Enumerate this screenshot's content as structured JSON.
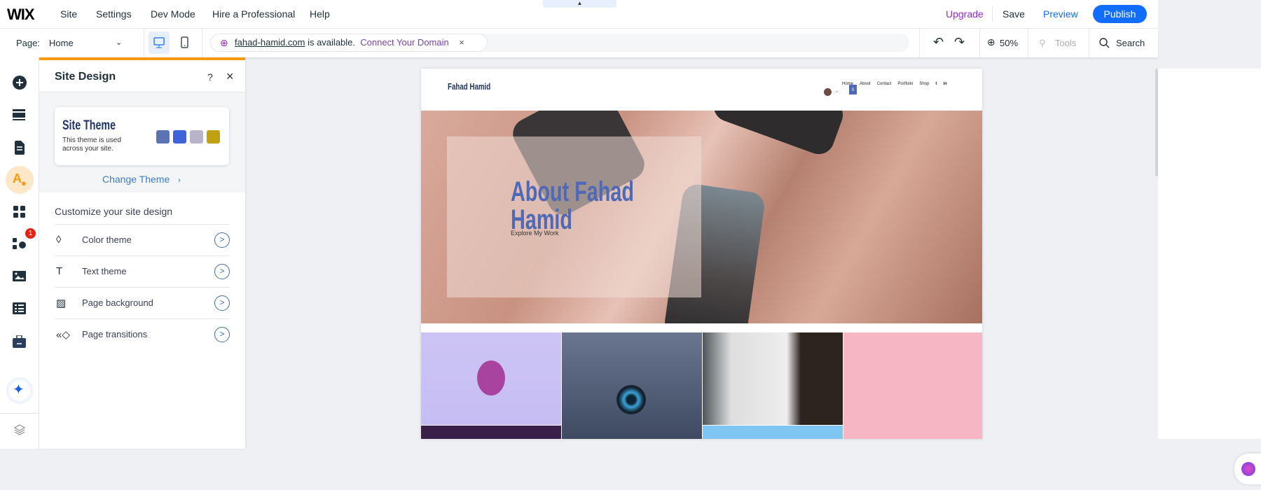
{
  "topbar": {
    "logo": "WIX",
    "menu": [
      "Site",
      "Settings",
      "Dev Mode",
      "Hire a Professional",
      "Help"
    ],
    "upgrade": "Upgrade",
    "save": "Save",
    "preview": "Preview",
    "publish": "Publish",
    "collapse_icon": "chevron-up-icon"
  },
  "toolbar": {
    "page_label": "Page:",
    "page_value": "Home",
    "domain": "fahad-hamid.com",
    "domain_suffix": "is available.",
    "connect": "Connect Your Domain",
    "dismiss": "×",
    "zoom": "50%",
    "tools": "Tools",
    "search": "Search"
  },
  "rail": {
    "badge": "1",
    "icons": [
      "add-icon",
      "sections-icon",
      "pages-icon",
      "site-design-icon",
      "apps-icon",
      "add-apps-icon",
      "media-icon",
      "cms-icon",
      "business-icon",
      "ai-assistant-icon",
      "layers-icon"
    ]
  },
  "panel": {
    "title": "Site Design",
    "help": "?",
    "close": "×",
    "theme": {
      "title": "Site Theme",
      "desc": "This theme is used across your site.",
      "colors": [
        "#5a73b5",
        "#3f63d9",
        "#b8b3c8",
        "#c0a10f"
      ]
    },
    "change_theme": "Change Theme",
    "customize": "Customize your site design",
    "items": [
      {
        "label": "Color theme",
        "icon": "droplet-icon"
      },
      {
        "label": "Text theme",
        "icon": "text-icon"
      },
      {
        "label": "Page background",
        "icon": "background-icon"
      },
      {
        "label": "Page transitions",
        "icon": "transitions-icon"
      }
    ]
  },
  "site": {
    "name": "Fahad Hamid",
    "nav": [
      "Home",
      "About",
      "Contact",
      "Portfolio",
      "Shop"
    ],
    "cart_count": "0",
    "hero_title": "About Fahad Hamid",
    "hero_link": "Explore My Work",
    "accent": "#5069b6"
  }
}
